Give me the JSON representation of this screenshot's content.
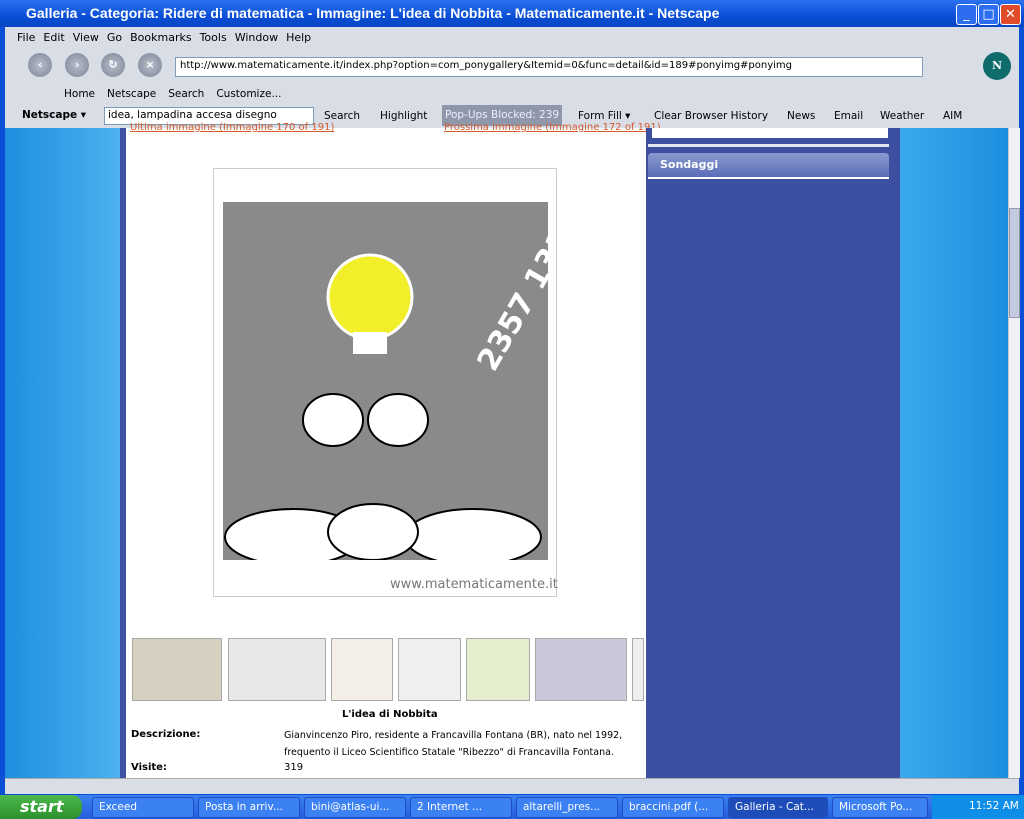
{
  "window": {
    "title": "Galleria - Categoria: Ridere di matematica - Immagine: L'idea di Nobbita - Matematicamente.it - Netscape"
  },
  "menu": [
    "File",
    "Edit",
    "View",
    "Go",
    "Bookmarks",
    "Tools",
    "Window",
    "Help"
  ],
  "url": "http://www.matematicamente.it/index.php?option=com_ponygallery&Itemid=0&func=detail&id=189#ponyimg#ponyimg",
  "personal_toolbar": [
    "Home",
    "Netscape",
    "Search",
    "Customize..."
  ],
  "search_toolbar": {
    "brand": "Netscape",
    "query": "idea, lampadina accesa disegno",
    "search": "Search",
    "highlight": "Highlight",
    "popups": "Pop-Ups Blocked: 239",
    "form_fill": "Form Fill",
    "clear_history": "Clear Browser History",
    "news": "News",
    "email": "Email",
    "weather": "Weather",
    "aim": "AIM"
  },
  "page": {
    "prev_link": "Ultima immagine (Immagine 170 of 191)",
    "next_link": "Prossima immagine (Immagine 172 of 191)",
    "watermark": "www.matematicamente.it",
    "image_title": "L'idea di Nobbita",
    "desc_label": "Descrizione:",
    "desc_text": "Gianvincenzo Piro, residente a Francavilla Fontana (BR), nato nel 1992, frequento il Liceo Scientifico Statale \"Ribezzo\" di Francavilla Fontana.",
    "visits_label": "Visite:",
    "visits": "319"
  },
  "sidebar": {
    "section": "Sondaggi"
  },
  "taskbar": {
    "start": "start",
    "tasks": [
      "Exceed",
      "Posta in arriv...",
      "bini@atlas-ui...",
      "2 Internet ...",
      "altarelli_pres...",
      "braccini.pdf (...",
      "Galleria - Cat...",
      "Microsoft Po..."
    ],
    "clock": "11:52 AM"
  }
}
